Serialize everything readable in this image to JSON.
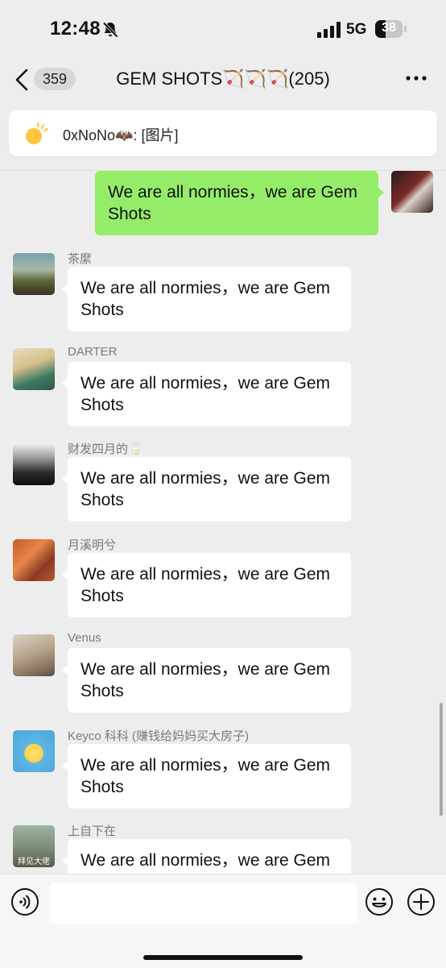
{
  "status": {
    "time": "12:48",
    "network": "5G",
    "battery": "38",
    "battery_level": 0.38,
    "bell_icon": "bell-slash-icon"
  },
  "nav": {
    "unread_count": "359",
    "title": "GEM SHOTS🏹🏹🏹(205)",
    "back_icon": "chevron-left-icon",
    "more_icon": "ellipsis-icon"
  },
  "notice": {
    "text": "0xNoNo🦇: [图片]",
    "icon": "sun-icon"
  },
  "messages": [
    {
      "sender": "",
      "text": "We are all normies，we are Gem Shots",
      "mine": true
    },
    {
      "sender": "茶縻",
      "text": "We are all normies，we are Gem Shots"
    },
    {
      "sender": "DARTER",
      "text": "We are all normies，we are Gem Shots"
    },
    {
      "sender": "财发四月的🥛",
      "text": "We are all normies，we are Gem Shots"
    },
    {
      "sender": "月溪明兮",
      "text": "We are all normies，we are Gem Shots"
    },
    {
      "sender": "Venus",
      "text": "We are all normies，we are Gem Shots"
    },
    {
      "sender": "Keyco 科科 (赚钱给妈妈买大房子)",
      "text": "We are all normies，we are Gem Shots"
    },
    {
      "sender": "上自下在",
      "text": "We are all normies，we are Gem",
      "avatar_caption": "拜见大佬"
    }
  ],
  "input": {
    "placeholder": "",
    "voice_icon": "voice-icon",
    "emoji_icon": "smiley-icon",
    "plus_icon": "plus-circle-icon"
  },
  "colors": {
    "background": "#ededed",
    "my_bubble": "#95ec69",
    "other_bubble": "#ffffff"
  }
}
